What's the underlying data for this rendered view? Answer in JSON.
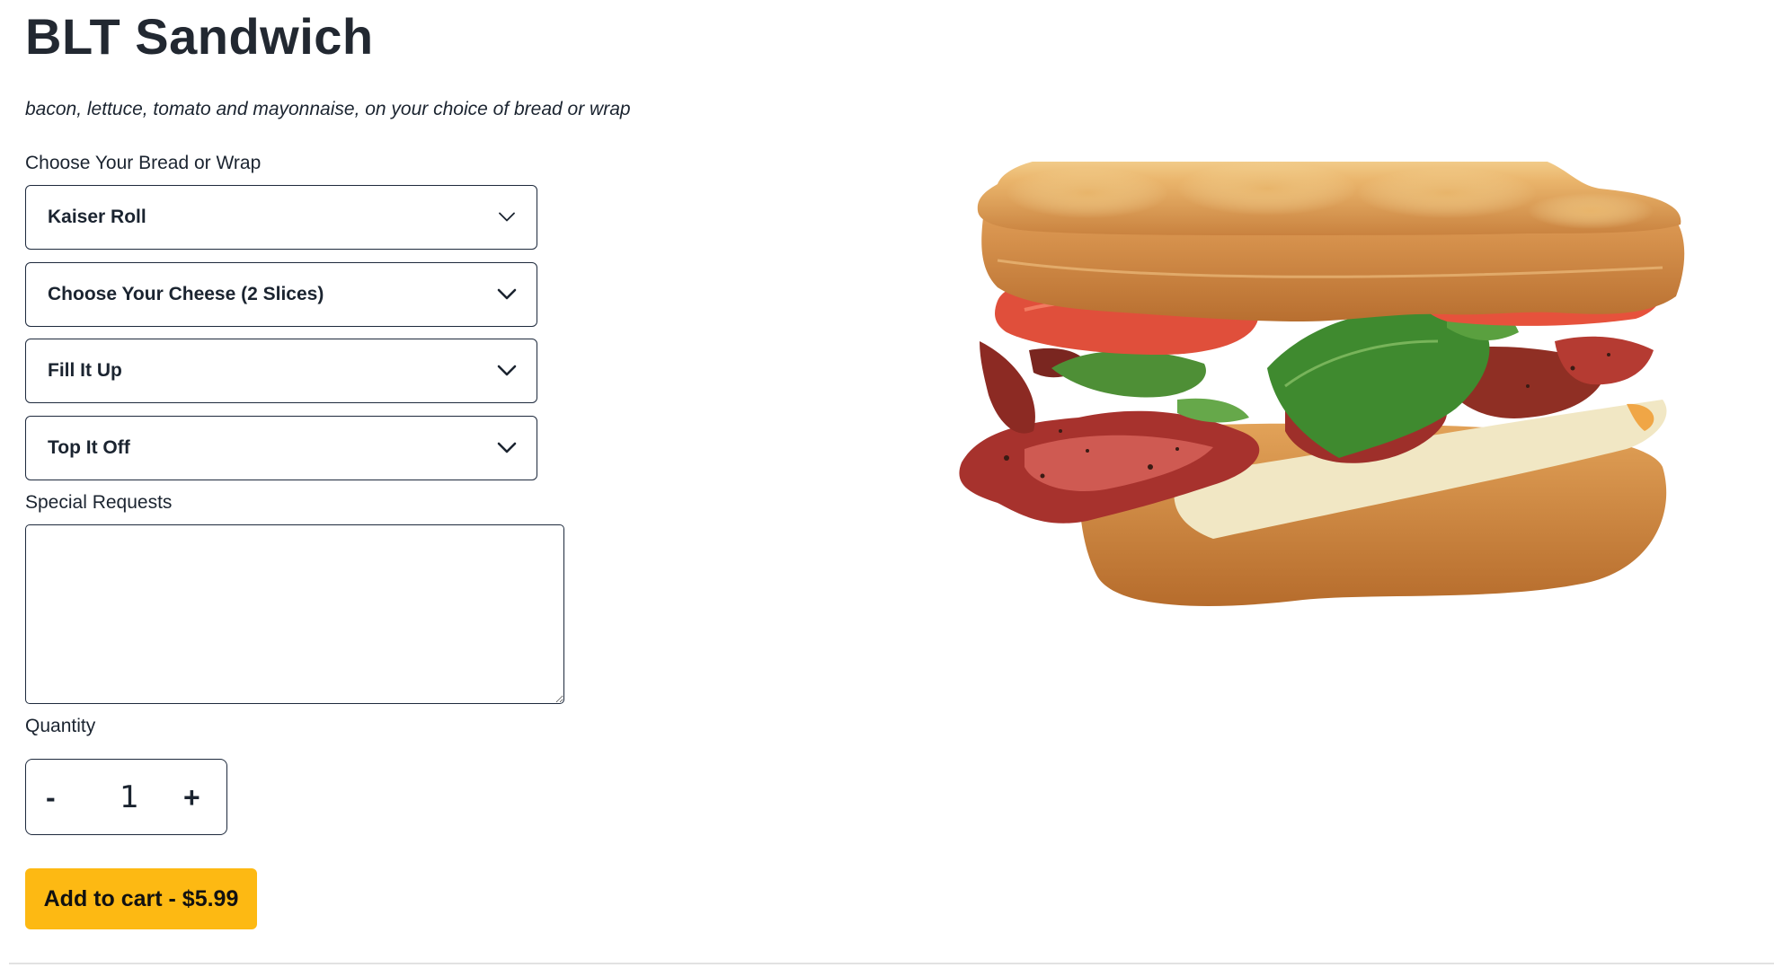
{
  "product": {
    "title": "BLT Sandwich",
    "description": "bacon, lettuce, tomato and mayonnaise, on your choice of bread or wrap"
  },
  "options": {
    "bread_label": "Choose Your Bread or Wrap",
    "bread_selected": "Kaiser Roll",
    "cheese": "Choose Your Cheese (2 Slices)",
    "fill": "Fill It Up",
    "top": "Top It Off"
  },
  "special_requests": {
    "label": "Special Requests",
    "value": ""
  },
  "quantity": {
    "label": "Quantity",
    "minus": "-",
    "value": "1",
    "plus": "+"
  },
  "cart": {
    "button_label": "Add to cart - $5.99"
  },
  "image": {
    "subject": "BLT sandwich photo"
  },
  "colors": {
    "accent": "#fdb913",
    "text": "#1b2430",
    "border": "#1e2a3d"
  }
}
